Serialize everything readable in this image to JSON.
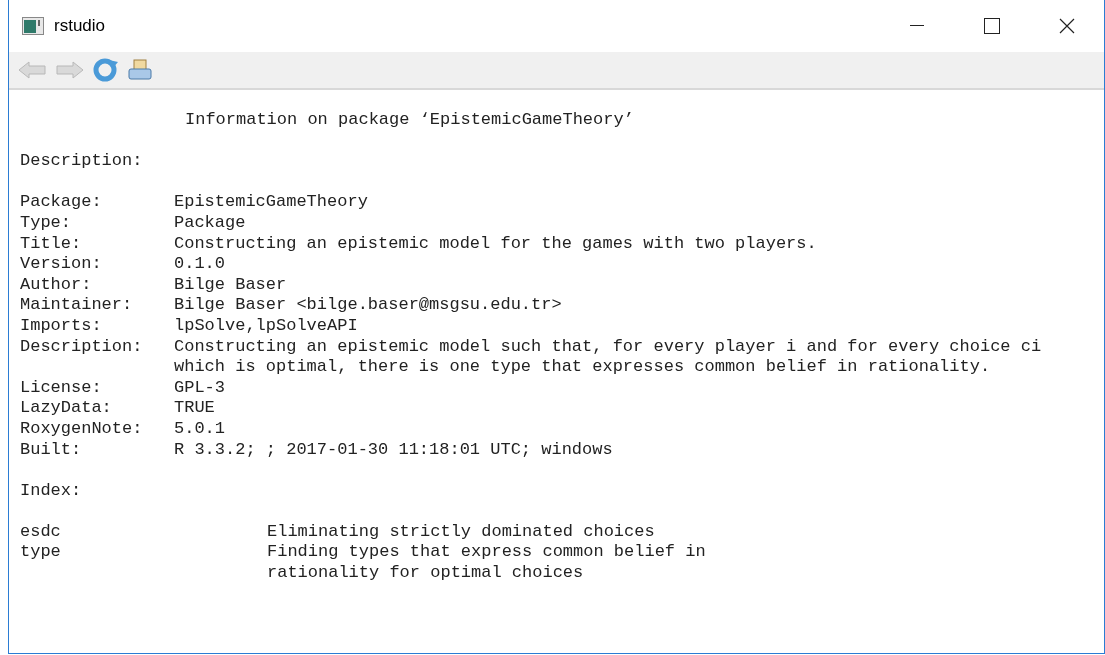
{
  "window": {
    "title": "rstudio"
  },
  "toolbar": [
    {
      "kind": "back",
      "disabled": true
    },
    {
      "kind": "forward",
      "disabled": true
    },
    {
      "kind": "refresh",
      "disabled": false
    },
    {
      "kind": "print",
      "disabled": false
    }
  ],
  "document": {
    "heading": "Information on package ‘EpistemicGameTheory’",
    "description_label": "Description:",
    "fields": [
      {
        "label": "Package:",
        "lines": [
          "EpistemicGameTheory"
        ]
      },
      {
        "label": "Type:",
        "lines": [
          "Package"
        ]
      },
      {
        "label": "Title:",
        "lines": [
          "Constructing an epistemic model for the games with two players."
        ]
      },
      {
        "label": "Version:",
        "lines": [
          "0.1.0"
        ]
      },
      {
        "label": "Author:",
        "lines": [
          "Bilge Baser"
        ]
      },
      {
        "label": "Maintainer:",
        "lines": [
          "Bilge Baser <bilge.baser@msgsu.edu.tr>"
        ]
      },
      {
        "label": "Imports:",
        "lines": [
          "lpSolve,lpSolveAPI"
        ]
      },
      {
        "label": "Description:",
        "lines": [
          "Constructing an epistemic model such that, for every player i and for every choice ci",
          "which is optimal, there is one type that expresses common belief in rationality."
        ]
      },
      {
        "label": "License:",
        "lines": [
          "GPL-3"
        ]
      },
      {
        "label": "LazyData:",
        "lines": [
          "TRUE"
        ]
      },
      {
        "label": "RoxygenNote:",
        "lines": [
          "5.0.1"
        ]
      },
      {
        "label": "Built:",
        "lines": [
          "R 3.3.2; ; 2017-01-30 11:18:01 UTC; windows"
        ]
      }
    ],
    "index_label": "Index:",
    "index": [
      {
        "name": "esdc",
        "lines": [
          "Eliminating strictly dominated choices"
        ]
      },
      {
        "name": "type",
        "lines": [
          "Finding types that express common belief in",
          "rationality for optimal choices"
        ]
      }
    ]
  }
}
